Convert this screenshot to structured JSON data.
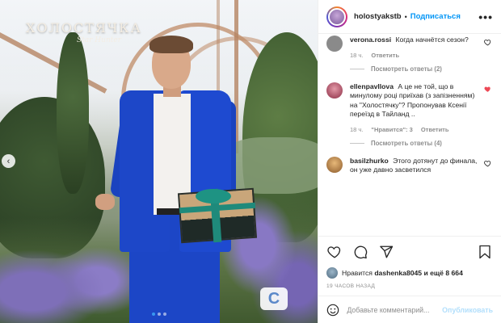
{
  "post": {
    "show_logo": "ХОЛОСТЯЧКА",
    "show_logo_sub": "Star Hunter",
    "nav_arrow": "‹",
    "channel_logo": "C",
    "carousel_dots": 3,
    "active_dot": 0
  },
  "header": {
    "username": "holostyakstb",
    "separator": "•",
    "follow_label": "Подписаться",
    "more": "•••"
  },
  "comments": [
    {
      "username": "verona.rossi",
      "text": "Когда начнётся сезон?",
      "time": "18 ч.",
      "reply_label": "Ответить",
      "likes_label": "",
      "view_replies": "Посмотреть ответы (2)",
      "liked": false,
      "avatar_color": "#8a8a8a"
    },
    {
      "username": "ellenpavllova",
      "text": "А це не той, що в минулому році приїхав (з запізненням) на \"Холостячку\"? Пропонував Ксенії переїзд в Тайланд ..",
      "time": "18 ч.",
      "likes_label": "\"Нравится\": 3",
      "reply_label": "Ответить",
      "view_replies": "Посмотреть ответы (4)",
      "liked": true,
      "avatar_color": "#b0425a"
    },
    {
      "username": "basilzhurko",
      "text": "Этого дотянут до финала, он уже давно засветился",
      "time": "",
      "likes_label": "",
      "reply_label": "",
      "view_replies": "",
      "liked": false,
      "avatar_color": "#c28a45"
    }
  ],
  "likes": {
    "prefix": "Нравится",
    "user": "dashenka8045",
    "suffix": "и ещё 8 664"
  },
  "time_ago": "19 ЧАСОВ НАЗАД",
  "add_comment": {
    "placeholder": "Добавьте комментарий...",
    "publish_label": "Опубликовать"
  }
}
